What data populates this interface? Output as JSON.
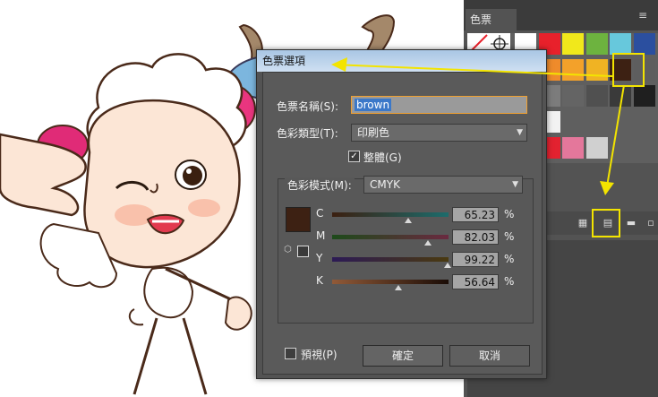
{
  "panel": {
    "tab_label": "色票",
    "menu_glyph": "≡",
    "swatch_colors": [
      [
        "#ffffff",
        "#ffffff",
        "#ffffff",
        "#e8212b",
        "#f1e81b",
        "#6db33f",
        "#67c8dc",
        "#2b4f9f"
      ],
      [
        "#f08c2e",
        "#ffffff",
        "#ffffff",
        "#ef8b2b",
        "#f3a12a",
        "#f0b323",
        "#3d2113",
        "#5e5e5e"
      ],
      [
        "#aaaaaa",
        "#aaaaaa",
        "#aaaaaa",
        "#7c7c7c",
        "#646464",
        "#505050",
        "#3a3a3a",
        "#1f1f1f"
      ],
      [
        "#ffffff",
        "#eeeeee",
        "#d7d7d7",
        "#f2f2f2",
        "#5f5f5f",
        "#5f5f5f",
        "#5f5f5f",
        "#5f5f5f"
      ],
      [
        "#ef8b2b",
        "#f29b36",
        "#f2a144",
        "#e32230",
        "#e4779b",
        "#d0d0d0",
        "#5f5f5f",
        "#5f5f5f"
      ]
    ],
    "highlight_color": "#f3e400",
    "bottom_icons": [
      "swatch-library-icon",
      "swatch-options-icon",
      "new-group-icon",
      "new-swatch-icon"
    ]
  },
  "dialog": {
    "title": "色票選項",
    "swatch_name_label": "色票名稱(S):",
    "swatch_name_value": "brown",
    "color_type_label": "色彩類型(T):",
    "color_type_value": "印刷色",
    "global_label": "整體(G)",
    "global_checked": true,
    "color_mode_label": "色彩模式(M):",
    "color_mode_value": "CMYK",
    "swatch_color": "#3d2113",
    "channels": [
      {
        "name": "C",
        "value": "65.23",
        "percent": 65.23,
        "gradient": [
          "#3b1f10",
          "#1d6c6c"
        ]
      },
      {
        "name": "M",
        "value": "82.03",
        "percent": 82.03,
        "gradient": [
          "#1d4a1a",
          "#6a2a40"
        ]
      },
      {
        "name": "Y",
        "value": "99.22",
        "percent": 99.22,
        "gradient": [
          "#2c1a55",
          "#4a3a10"
        ]
      },
      {
        "name": "K",
        "value": "56.64",
        "percent": 56.64,
        "gradient": [
          "#915a38",
          "#1a0c06"
        ]
      }
    ],
    "percent_sign": "%",
    "preview_label": "預視(P)",
    "ok_label": "確定",
    "cancel_label": "取消"
  }
}
